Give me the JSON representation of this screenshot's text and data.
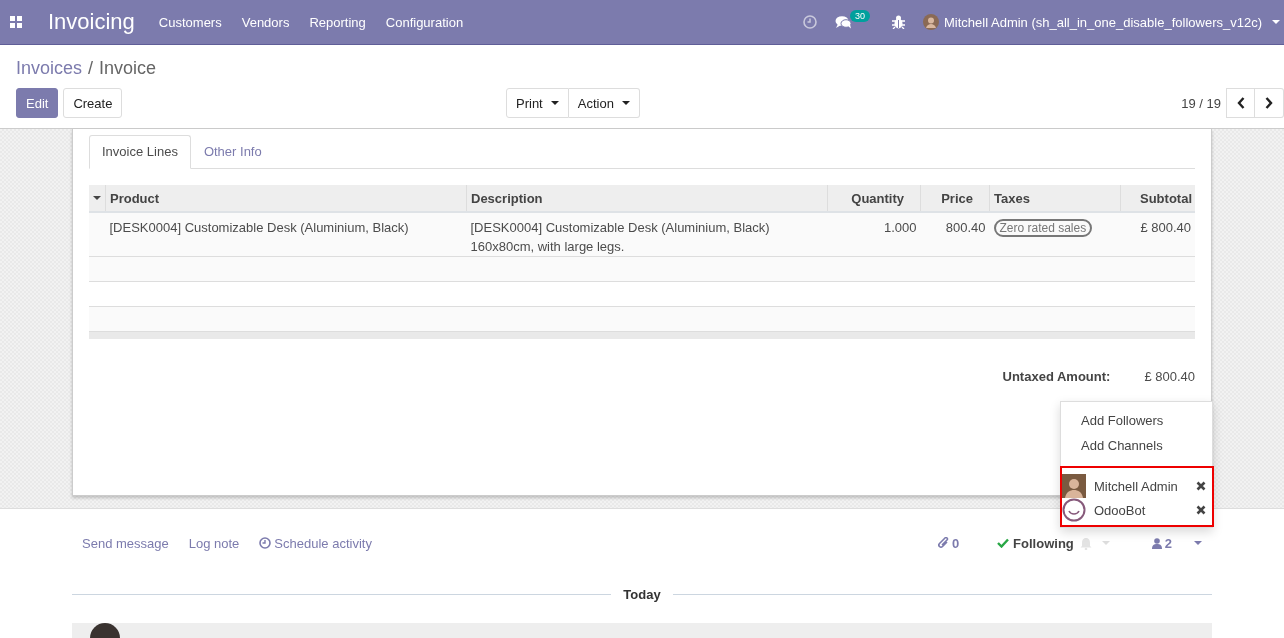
{
  "navbar": {
    "app_title": "Invoicing",
    "menu": [
      "Customers",
      "Vendors",
      "Reporting",
      "Configuration"
    ],
    "messages_badge": "30",
    "user_name": "Mitchell Admin (sh_all_in_one_disable_followers_v12c)"
  },
  "breadcrumb": {
    "items": [
      "Invoices",
      "Invoice"
    ],
    "separator": "/"
  },
  "buttons": [
    {
      "label": "Edit",
      "kind": "primary"
    },
    {
      "label": "Create",
      "kind": "secondary"
    }
  ],
  "dropdowns": [
    "Print",
    "Action"
  ],
  "pager": "19 / 19",
  "tabs": [
    {
      "label": "Invoice Lines",
      "selected": true
    },
    {
      "label": "Other Info",
      "selected": false
    }
  ],
  "table": {
    "columns": [
      {
        "label": "Product",
        "kind": "text"
      },
      {
        "label": "Description",
        "kind": "text"
      },
      {
        "label": "Quantity",
        "kind": "number"
      },
      {
        "label": "Price",
        "kind": "number"
      },
      {
        "label": "Taxes",
        "kind": "tags"
      },
      {
        "label": "Subtotal",
        "kind": "number"
      }
    ],
    "rows": [
      {
        "cells": [
          "[DESK0004] Customizable Desk (Aluminium, Black)",
          "[DESK0004] Customizable Desk (Aluminium, Black)\n160x80cm, with large legs.",
          "1.000",
          "800.40",
          "Zero rated sales",
          "£ 800.40"
        ]
      }
    ]
  },
  "totals": [
    {
      "label": "Untaxed Amount:",
      "value": "£ 800.40"
    }
  ],
  "chatter": {
    "actions": [
      {
        "label": "Send message",
        "kind": "plain"
      },
      {
        "label": "Log note",
        "kind": "plain"
      },
      {
        "label": "Schedule activity",
        "kind": "clock"
      }
    ],
    "attachments": "0",
    "following": "Following",
    "followers_count": "2",
    "date_divider": "Today"
  },
  "followers_menu": {
    "items": [
      "Add Followers",
      "Add Channels"
    ],
    "followers": [
      {
        "name": "Mitchell Admin",
        "kind": "photo"
      },
      {
        "name": "OdooBot",
        "kind": "bot"
      }
    ]
  }
}
